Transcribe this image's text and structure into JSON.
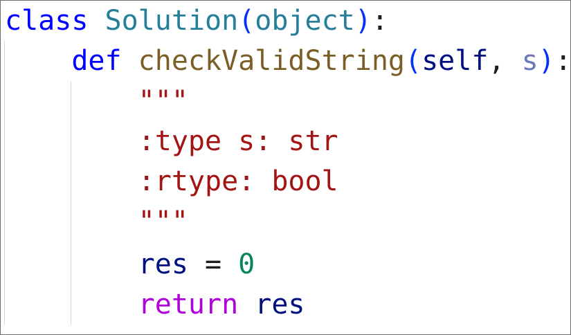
{
  "editor": {
    "lines": [
      {
        "tokens": [
          {
            "t": "class",
            "c": "kw"
          },
          {
            "t": " ",
            "c": "punc"
          },
          {
            "t": "Solution",
            "c": "cls"
          },
          {
            "t": "(",
            "c": "paren"
          },
          {
            "t": "object",
            "c": "cls"
          },
          {
            "t": ")",
            "c": "paren"
          },
          {
            "t": ":",
            "c": "punc"
          }
        ]
      },
      {
        "tokens": [
          {
            "t": "    ",
            "c": "punc"
          },
          {
            "t": "def",
            "c": "kw"
          },
          {
            "t": " ",
            "c": "punc"
          },
          {
            "t": "checkValidString",
            "c": "fn"
          },
          {
            "t": "(",
            "c": "paren"
          },
          {
            "t": "self",
            "c": "var"
          },
          {
            "t": ", ",
            "c": "punc"
          },
          {
            "t": "s",
            "c": "param"
          },
          {
            "t": ")",
            "c": "paren"
          },
          {
            "t": ":",
            "c": "punc"
          }
        ]
      },
      {
        "tokens": [
          {
            "t": "        ",
            "c": "punc"
          },
          {
            "t": "\"\"\"",
            "c": "str"
          }
        ]
      },
      {
        "tokens": [
          {
            "t": "        ",
            "c": "punc"
          },
          {
            "t": ":type s: str",
            "c": "str"
          }
        ]
      },
      {
        "tokens": [
          {
            "t": "        ",
            "c": "punc"
          },
          {
            "t": ":rtype: bool",
            "c": "str"
          }
        ]
      },
      {
        "tokens": [
          {
            "t": "        ",
            "c": "punc"
          },
          {
            "t": "\"\"\"",
            "c": "str"
          }
        ]
      },
      {
        "tokens": [
          {
            "t": "        ",
            "c": "punc"
          },
          {
            "t": "res",
            "c": "var"
          },
          {
            "t": " = ",
            "c": "punc"
          },
          {
            "t": "0",
            "c": "num"
          }
        ]
      },
      {
        "tokens": [
          {
            "t": "        ",
            "c": "punc"
          },
          {
            "t": "return",
            "c": "kw2"
          },
          {
            "t": " ",
            "c": "punc"
          },
          {
            "t": "res",
            "c": "var"
          }
        ]
      }
    ]
  }
}
